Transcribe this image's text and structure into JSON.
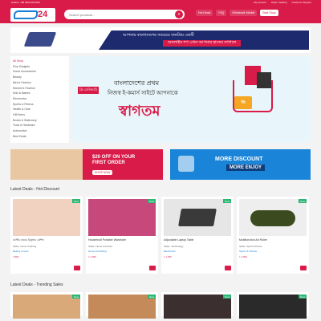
{
  "topbar": {
    "text": "Hotline: +88 0000-000-000",
    "links": [
      "My Account",
      "Order Tracking",
      "Customer Support"
    ]
  },
  "header": {
    "logo_text": "24",
    "search_placeholder": "Search products...",
    "search_button": "⌕",
    "nav": [
      "Hot Deals",
      "FAQ",
      "Wholesale Market",
      "Best Shop"
    ]
  },
  "promo": {
    "line1": "আপনার বাংলাদেশের সবচেয়ে জনপ্রিয় একটি",
    "line2": "অনলাইন শপ এখন আপনার হাতের নাগালে"
  },
  "categories": [
    "All Shop",
    "Fine Gadgets",
    "Home Accessories",
    "Beauty",
    "Men's Fashion",
    "Women's Fashion",
    "Kids & Babies",
    "Electronics",
    "Sports & Fitness",
    "Health & Care",
    "Gift Items",
    "Books & Stationery",
    "Tools & Hardware",
    "Automotive",
    "Best Deals"
  ],
  "hero": {
    "tag": "ফ্রি ডেলিভারি",
    "line1": "বাংলাদেশের প্রথম",
    "line2": "নিজস্ব ই-কমার্স সাইটে আপনাকে",
    "headline": "স্বাগতম",
    "discount": "%"
  },
  "offers": {
    "first": {
      "line1": "$20 OFF ON YOUR",
      "line2": "FIRST ORDER",
      "button": "SHOP NOW"
    },
    "second": {
      "line1": "MORE DISCOUNT",
      "line2": "MORE ENJOY"
    }
  },
  "sections": {
    "latest": "Latest Deals - Hot Discount",
    "trending": "Latest Deals - Trending Sales"
  },
  "products": [
    {
      "name": "কাস্টম হেয়ার রিমুভার মেশিন",
      "badge": "New",
      "seller": "Seller: Home Clothing",
      "category": "Beauty & Care",
      "price": "৳ 890",
      "color": "#f1d2c0"
    },
    {
      "name": "Household Portable Wardrobe",
      "badge": "New",
      "seller": "Seller: Home Furniture",
      "category": "Home Furnishing",
      "price": "৳ 2,450",
      "color": "#c7487a"
    },
    {
      "name": "Adjustable Laptop Table",
      "badge": "New",
      "seller": "Seller: Technology",
      "category": "Electronics",
      "price": "৳ 1,250",
      "color": "#3a3a3a"
    },
    {
      "name": "Multifunction Ab Roller",
      "badge": "New",
      "seller": "Seller: Sports Fitness",
      "category": "Sports & Fitness",
      "price": "৳ 1,690",
      "color": "#3c4a1f"
    }
  ],
  "trending": [
    {
      "badge": "New",
      "color": "#d9a97a"
    },
    {
      "badge": "New",
      "color": "#c58a5a"
    },
    {
      "badge": "New",
      "color": "#3b2f2f"
    },
    {
      "badge": "New",
      "color": "#2a2a2a"
    }
  ]
}
